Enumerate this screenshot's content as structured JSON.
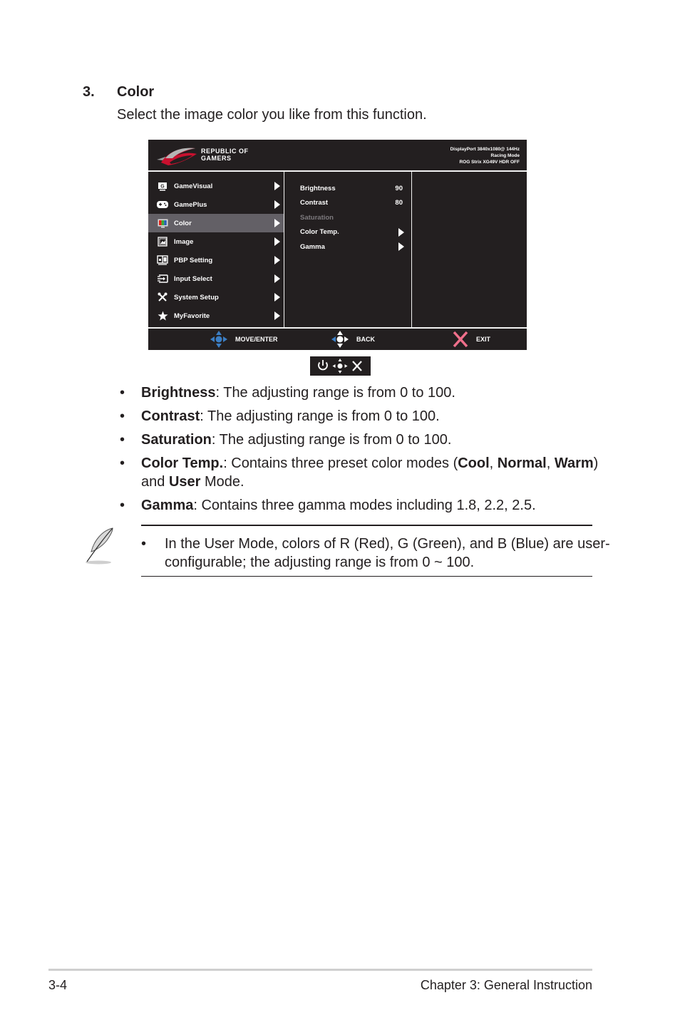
{
  "section": {
    "number": "3.",
    "title": "Color",
    "description": "Select the image color you like from this function."
  },
  "osd": {
    "brand_line1": "REPUBLIC OF",
    "brand_line2": "GAMERS",
    "status": [
      "DisplayPort 3840x1080@ 144Hz",
      "Racing Mode",
      "ROG Strix XG49V HDR OFF"
    ],
    "menu": [
      {
        "label": "GameVisual",
        "icon": "gamevisual-icon",
        "active": false
      },
      {
        "label": "GamePlus",
        "icon": "gamepad-icon",
        "active": false
      },
      {
        "label": "Color",
        "icon": "color-monitor-icon",
        "active": true
      },
      {
        "label": "Image",
        "icon": "image-icon",
        "active": false
      },
      {
        "label": "PBP Setting",
        "icon": "pbp-icon",
        "active": false
      },
      {
        "label": "Input Select",
        "icon": "input-icon",
        "active": false
      },
      {
        "label": "System Setup",
        "icon": "tools-icon",
        "active": false
      },
      {
        "label": "MyFavorite",
        "icon": "star-icon",
        "active": false
      }
    ],
    "submenu": [
      {
        "label": "Brightness",
        "value": "90",
        "enabled": true
      },
      {
        "label": "Contrast",
        "value": "80",
        "enabled": true
      },
      {
        "label": "Saturation",
        "value": "",
        "enabled": false
      },
      {
        "label": "Color Temp.",
        "value": "",
        "enabled": true,
        "has_arrow": true
      },
      {
        "label": "Gamma",
        "value": "",
        "enabled": true,
        "has_arrow": true
      }
    ],
    "footer": {
      "move": "MOVE/ENTER",
      "back": "BACK",
      "exit": "EXIT"
    },
    "colors": {
      "background": "#231f20",
      "active_row": "#636066",
      "nav_blue": "#3b7ec4",
      "exit_pink": "#ef6f8b"
    }
  },
  "bullets": [
    {
      "term": "Brightness",
      "text": ": The adjusting range is from 0 to 100."
    },
    {
      "term": "Contrast",
      "text": ": The adjusting range is from 0 to 100."
    },
    {
      "term": "Saturation",
      "text": ": The adjusting range is from 0 to 100."
    },
    {
      "term": "Color Temp.",
      "text": ": Contains three preset color modes (",
      "cool": "Cool",
      "sep1": ", ",
      "normal": "Normal",
      "sep2": ", ",
      "warm": "Warm",
      "and": ") and ",
      "user": "User",
      "tail": " Mode."
    },
    {
      "term": "Gamma",
      "text": ": Contains three gamma modes including 1.8, 2.2, 2.5."
    }
  ],
  "bullet_char": "•",
  "note": {
    "text": "In the User Mode, colors of R (Red), G (Green), and B (Blue) are user-configurable; the adjusting range is from 0 ~ 100."
  },
  "footer": {
    "page": "3-4",
    "chapter": "Chapter 3: General Instruction"
  }
}
